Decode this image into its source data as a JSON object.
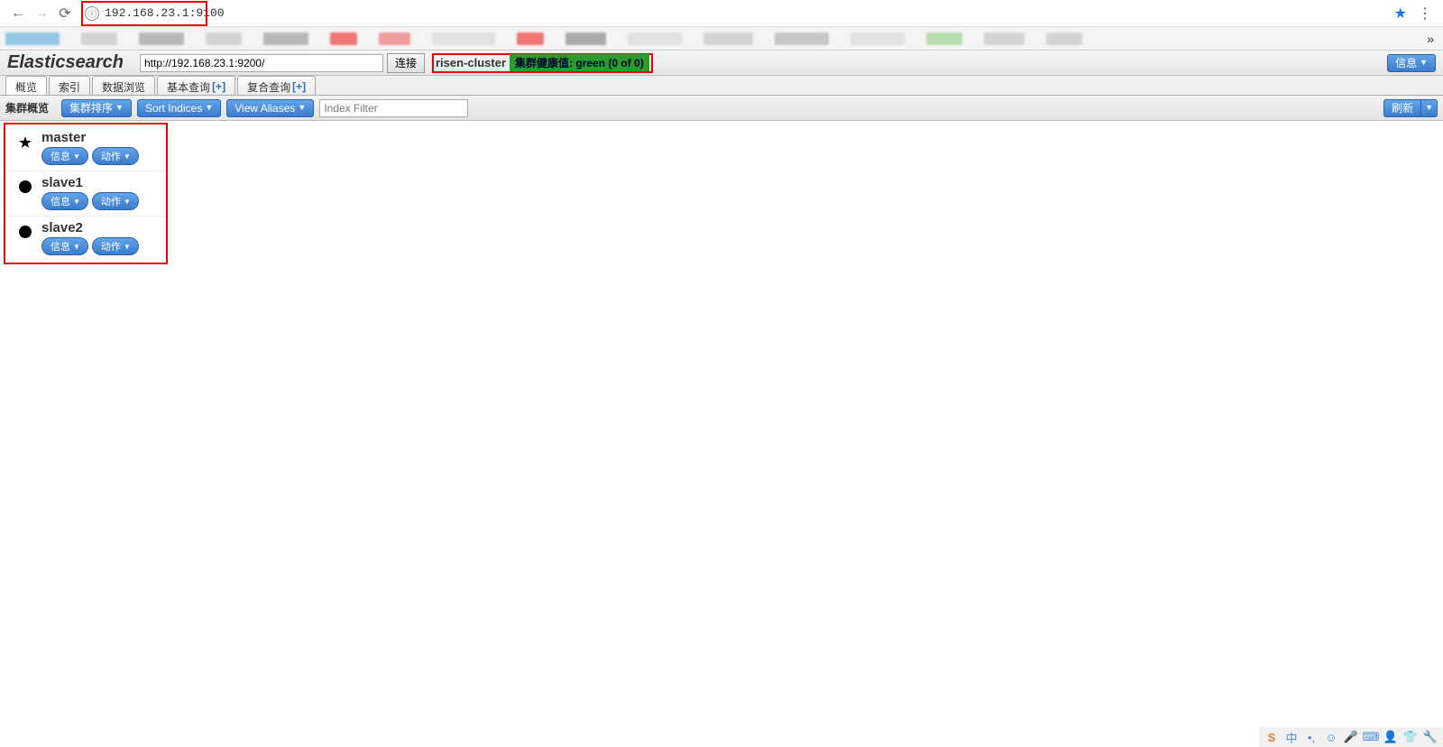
{
  "browser": {
    "url": "192.168.23.1:9100"
  },
  "bookmarks": {
    "more": "»"
  },
  "header": {
    "title": "Elasticsearch",
    "url_value": "http://192.168.23.1:9200/",
    "connect_label": "连接",
    "cluster_name": "risen-cluster",
    "health_text": "集群健康值: green (0 of 0)",
    "info_label": "信息"
  },
  "tabs": [
    {
      "label": "概览",
      "plus": false
    },
    {
      "label": "索引",
      "plus": false
    },
    {
      "label": "数据浏览",
      "plus": false
    },
    {
      "label": "基本查询",
      "plus": true
    },
    {
      "label": "复合查询",
      "plus": true
    }
  ],
  "toolbar": {
    "overview_label": "集群概览",
    "sort_cluster": "集群排序",
    "sort_indices": "Sort Indices",
    "view_aliases": "View Aliases",
    "filter_placeholder": "Index Filter",
    "refresh_label": "刷新"
  },
  "nodes": [
    {
      "name": "master",
      "master": true,
      "info": "信息",
      "action": "动作"
    },
    {
      "name": "slave1",
      "master": false,
      "info": "信息",
      "action": "动作"
    },
    {
      "name": "slave2",
      "master": false,
      "info": "信息",
      "action": "动作"
    }
  ],
  "taskbar": {
    "items": [
      "S",
      "中",
      "•,",
      "☺",
      "🎤",
      "⌨",
      "👤",
      "👕",
      "🔧"
    ]
  }
}
